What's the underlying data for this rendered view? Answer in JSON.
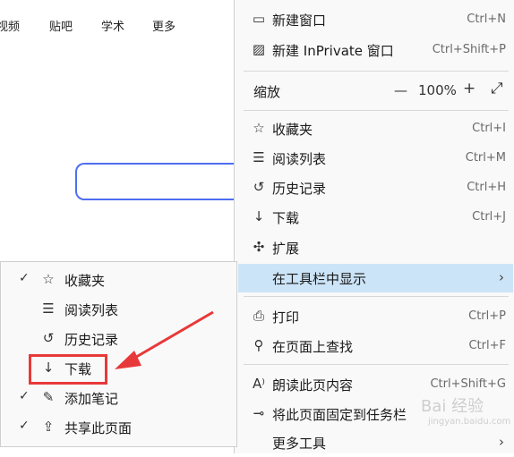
{
  "background": {
    "nav": [
      "视频",
      "贴吧",
      "学术",
      "更多"
    ]
  },
  "main_menu": {
    "items": [
      {
        "icon": "new-window-icon",
        "label": "新建窗口",
        "shortcut": "Ctrl+N"
      },
      {
        "icon": "inprivate-window-icon",
        "label": "新建 InPrivate 窗口",
        "shortcut": "Ctrl+Shift+P"
      },
      {
        "icon": "star-icon",
        "label": "收藏夹",
        "shortcut": "Ctrl+I"
      },
      {
        "icon": "reading-list-icon",
        "label": "阅读列表",
        "shortcut": "Ctrl+M"
      },
      {
        "icon": "history-icon",
        "label": "历史记录",
        "shortcut": "Ctrl+H"
      },
      {
        "icon": "download-icon",
        "label": "下载",
        "shortcut": "Ctrl+J"
      },
      {
        "icon": "extensions-icon",
        "label": "扩展",
        "shortcut": ""
      },
      {
        "icon": "",
        "label": "在工具栏中显示",
        "shortcut": ""
      },
      {
        "icon": "print-icon",
        "label": "打印",
        "shortcut": "Ctrl+P"
      },
      {
        "icon": "find-icon",
        "label": "在页面上查找",
        "shortcut": "Ctrl+F"
      },
      {
        "icon": "read-aloud-icon",
        "label": "朗读此页内容",
        "shortcut": "Ctrl+Shift+G"
      },
      {
        "icon": "pin-icon",
        "label": "将此页面固定到任务栏",
        "shortcut": ""
      },
      {
        "icon": "",
        "label": "更多工具",
        "shortcut": ""
      }
    ],
    "zoom": {
      "label": "缩放",
      "minus": "—",
      "value": "100%",
      "plus": "+",
      "fullscreen": "⤢"
    }
  },
  "sub_menu": {
    "items": [
      {
        "checked": true,
        "icon": "star-icon",
        "label": "收藏夹"
      },
      {
        "checked": false,
        "icon": "reading-list-icon",
        "label": "阅读列表"
      },
      {
        "checked": false,
        "icon": "history-icon",
        "label": "历史记录"
      },
      {
        "checked": false,
        "icon": "download-icon",
        "label": "下载"
      },
      {
        "checked": true,
        "icon": "pen-icon",
        "label": "添加笔记"
      },
      {
        "checked": true,
        "icon": "share-icon",
        "label": "共享此页面"
      }
    ]
  },
  "watermark": {
    "text": "Bai 经验",
    "sub": "jingyan.baidu.com"
  },
  "colors": {
    "highlight": "#cce4f7",
    "annotation": "#e8393a",
    "search_border": "#4e6ef2"
  }
}
